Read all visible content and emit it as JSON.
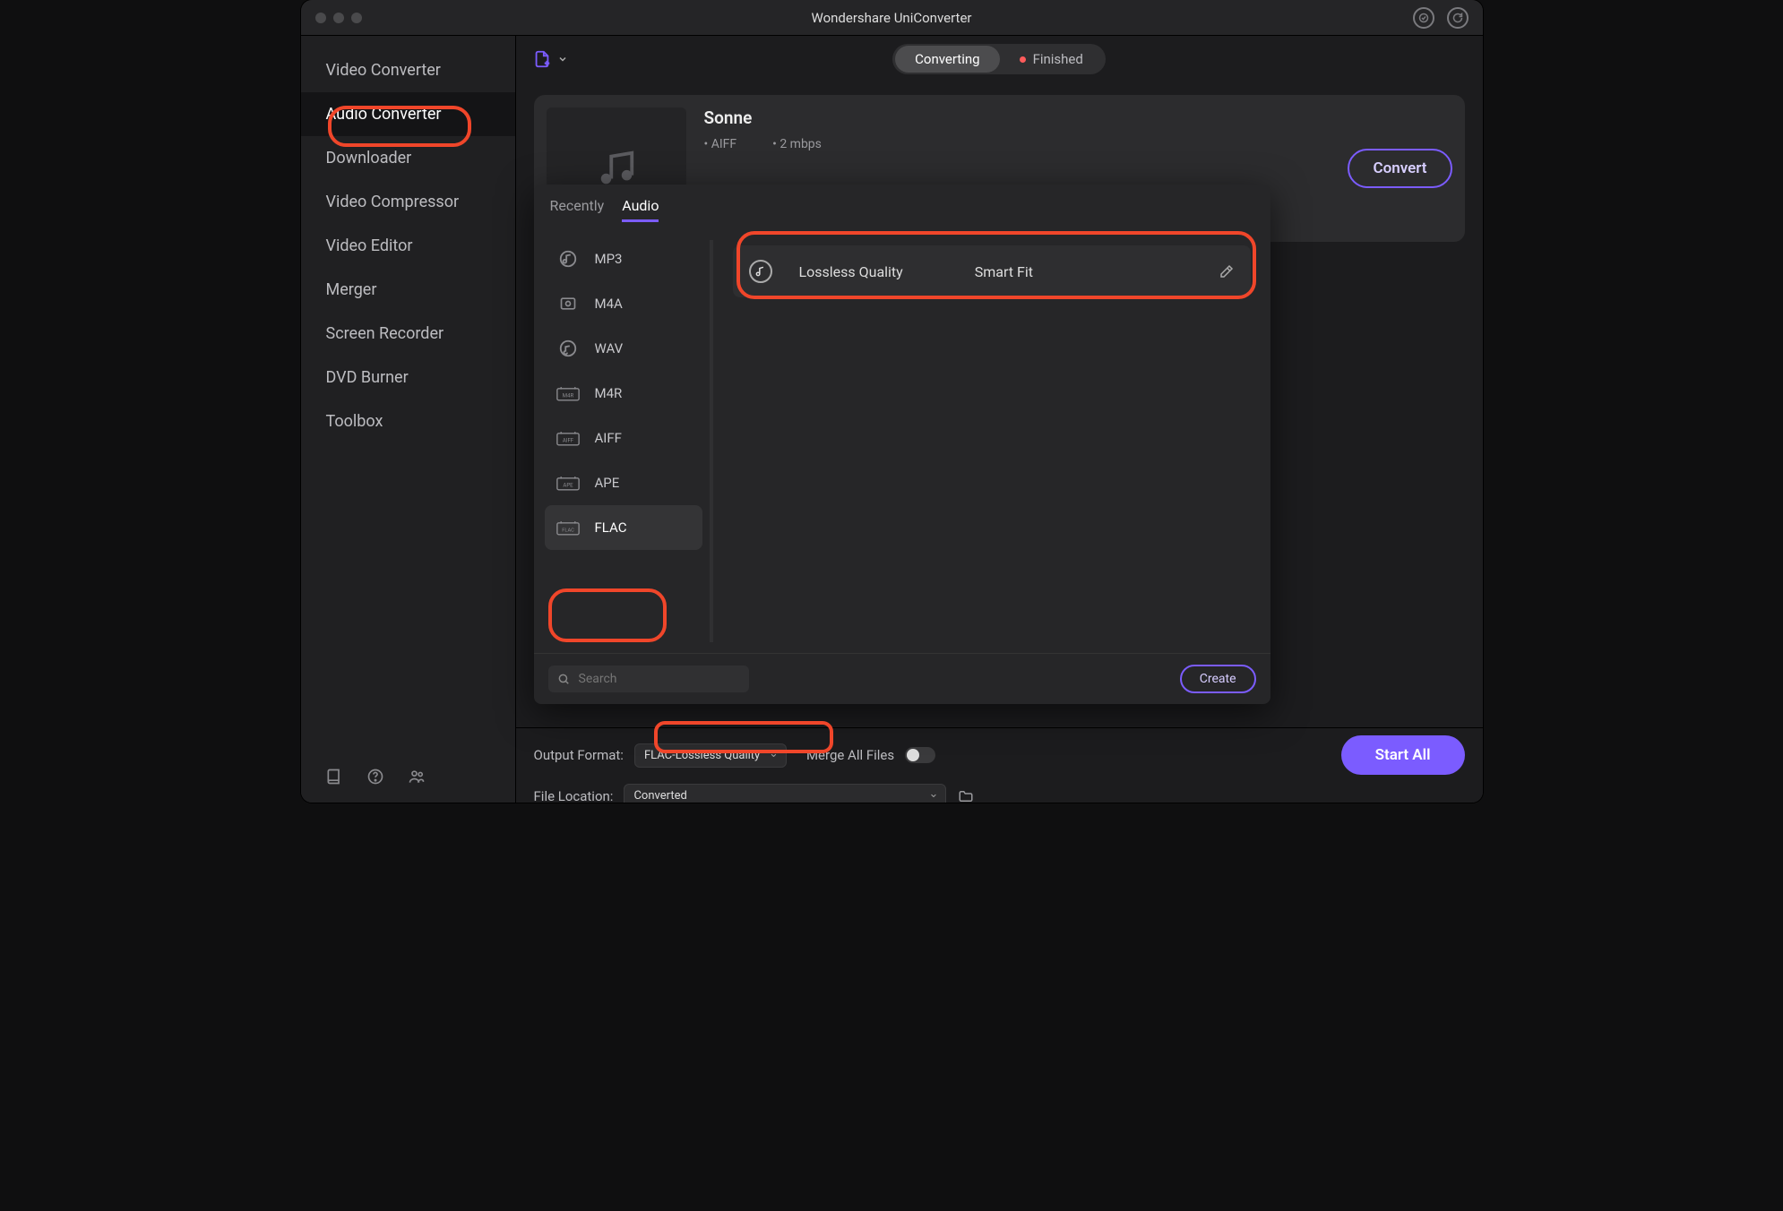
{
  "app_title": "Wondershare UniConverter",
  "sidebar": {
    "items": [
      {
        "label": "Video Converter"
      },
      {
        "label": "Audio Converter"
      },
      {
        "label": "Downloader"
      },
      {
        "label": "Video Compressor"
      },
      {
        "label": "Video Editor"
      },
      {
        "label": "Merger"
      },
      {
        "label": "Screen Recorder"
      },
      {
        "label": "DVD Burner"
      },
      {
        "label": "Toolbox"
      }
    ],
    "active_index": 1
  },
  "segmented": {
    "converting": "Converting",
    "finished": "Finished",
    "active": "converting"
  },
  "track": {
    "title": "Sonne",
    "format": "AIFF",
    "bitrate": "2 mbps",
    "convert_label": "Convert"
  },
  "popover": {
    "tabs": {
      "recently": "Recently",
      "audio": "Audio",
      "active": "audio"
    },
    "formats": [
      "MP3",
      "M4A",
      "WAV",
      "M4R",
      "AIFF",
      "APE",
      "FLAC"
    ],
    "selected_format_index": 6,
    "quality": {
      "label": "Lossless Quality",
      "fit": "Smart Fit"
    },
    "search_placeholder": "Search",
    "create_label": "Create"
  },
  "bottom": {
    "output_format_label": "Output Format:",
    "output_format_value": "FLAC-Lossless Quality",
    "merge_label": "Merge All Files",
    "merge_on": false,
    "file_location_label": "File Location:",
    "file_location_value": "Converted",
    "start_all_label": "Start All"
  }
}
